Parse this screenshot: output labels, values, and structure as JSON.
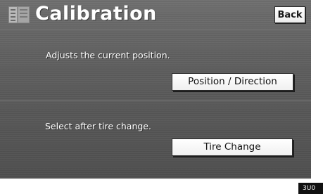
{
  "header": {
    "title": "Calibration",
    "menu_icon": "list-menu-icon",
    "back_label": "Back"
  },
  "position_section": {
    "description": "Adjusts the current position.",
    "button_label": "Position / Direction"
  },
  "tire_section": {
    "description": "Select after tire change.",
    "button_label": "Tire Change"
  },
  "figure_code": "3U0",
  "colors": {
    "screen_background": "#5f5f5f",
    "button_background": "#ffffff",
    "text": "#ffffff"
  }
}
